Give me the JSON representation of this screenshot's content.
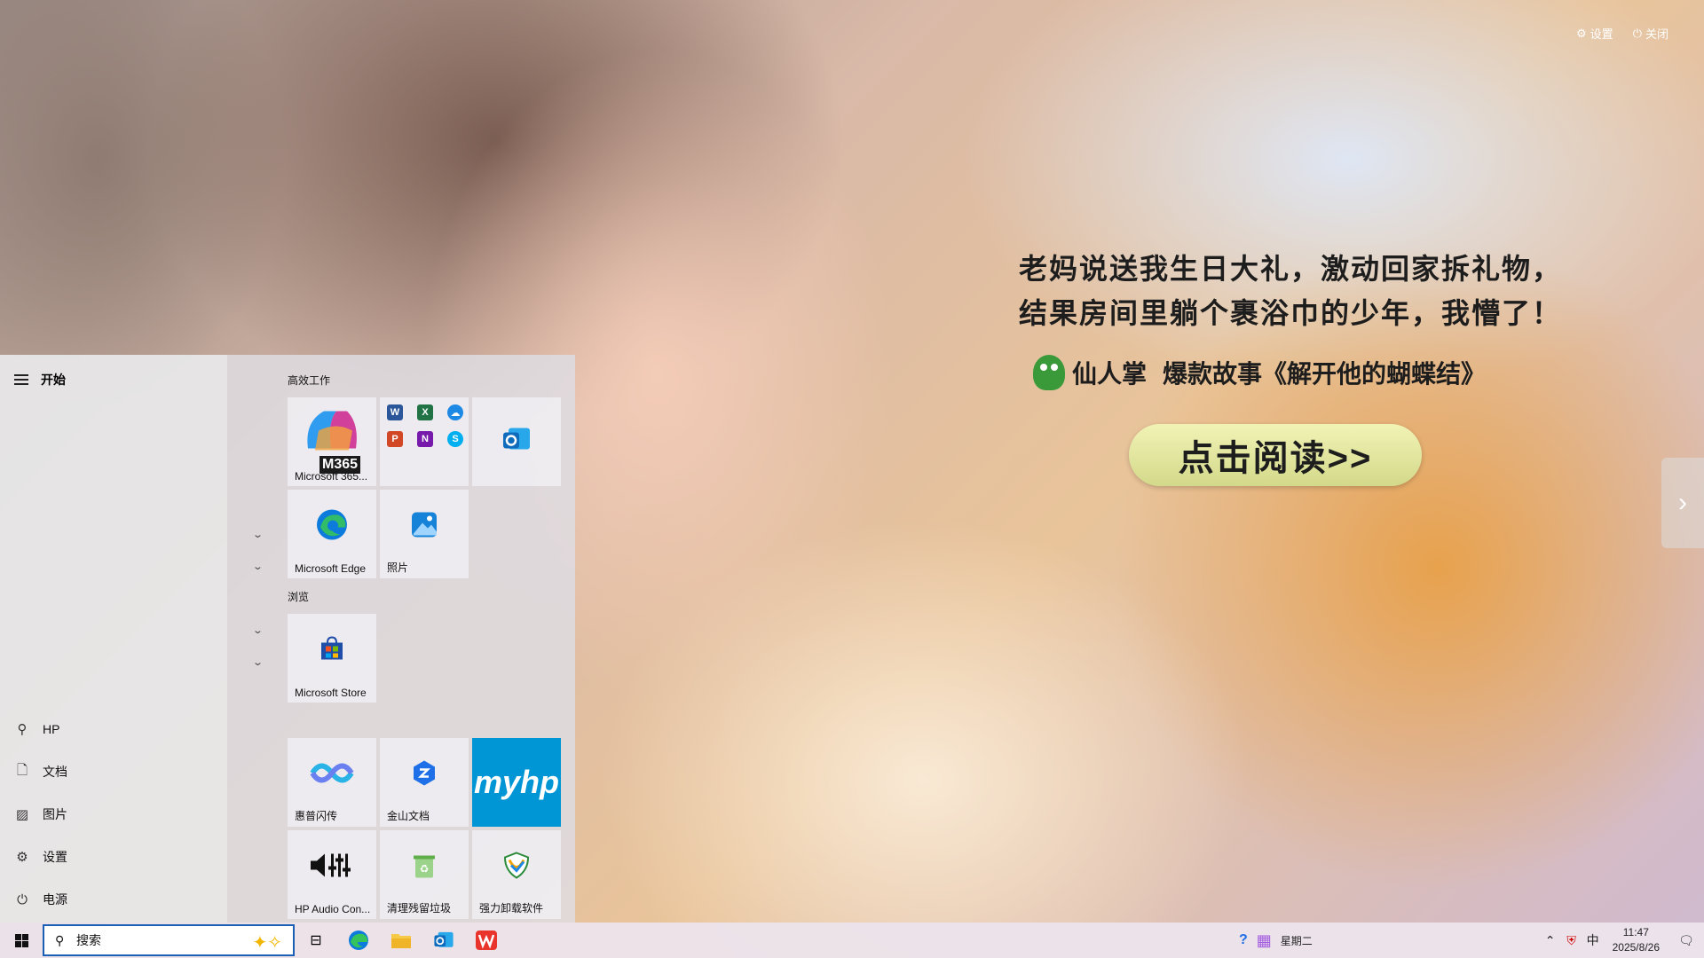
{
  "ad": {
    "settings_label": "设置",
    "close_label": "关闭",
    "headline_line1": "老妈说送我生日大礼，激动回家拆礼物，",
    "headline_line2": "结果房间里躺个裹浴巾的少年，我懵了！",
    "brand": "仙人掌",
    "story": "爆款故事《解开他的蝴蝶结》",
    "cta": "点击阅读>>"
  },
  "start_menu": {
    "title": "开始",
    "rail_items": [
      {
        "label": "HP",
        "icon": "user-icon"
      },
      {
        "label": "文档",
        "icon": "document-icon"
      },
      {
        "label": "图片",
        "icon": "pictures-icon"
      },
      {
        "label": "设置",
        "icon": "gear-icon"
      },
      {
        "label": "电源",
        "icon": "power-icon"
      }
    ],
    "groups": {
      "productivity": "高效工作",
      "browse": "浏览"
    },
    "tiles": {
      "m365_label": "Microsoft 365...",
      "m365_badge": "M365",
      "edge_label": "Microsoft Edge",
      "photos_label": "照片",
      "store_label": "Microsoft Store",
      "huipu_label": "惠普闪传",
      "kingsoft_label": "金山文档",
      "myhp_text": "myhp",
      "audio_label": "HP Audio Con...",
      "cleanup_label": "清理残留垃圾",
      "uninstall_label": "强力卸载软件"
    }
  },
  "taskbar": {
    "search_placeholder": "搜索",
    "weekday": "星期二",
    "ime": "中",
    "time": "11:47",
    "date": "2025/8/26"
  },
  "colors": {
    "accent": "#1a5fb4",
    "myhp": "#0096d6",
    "cta_bg": "#e3e69f"
  }
}
